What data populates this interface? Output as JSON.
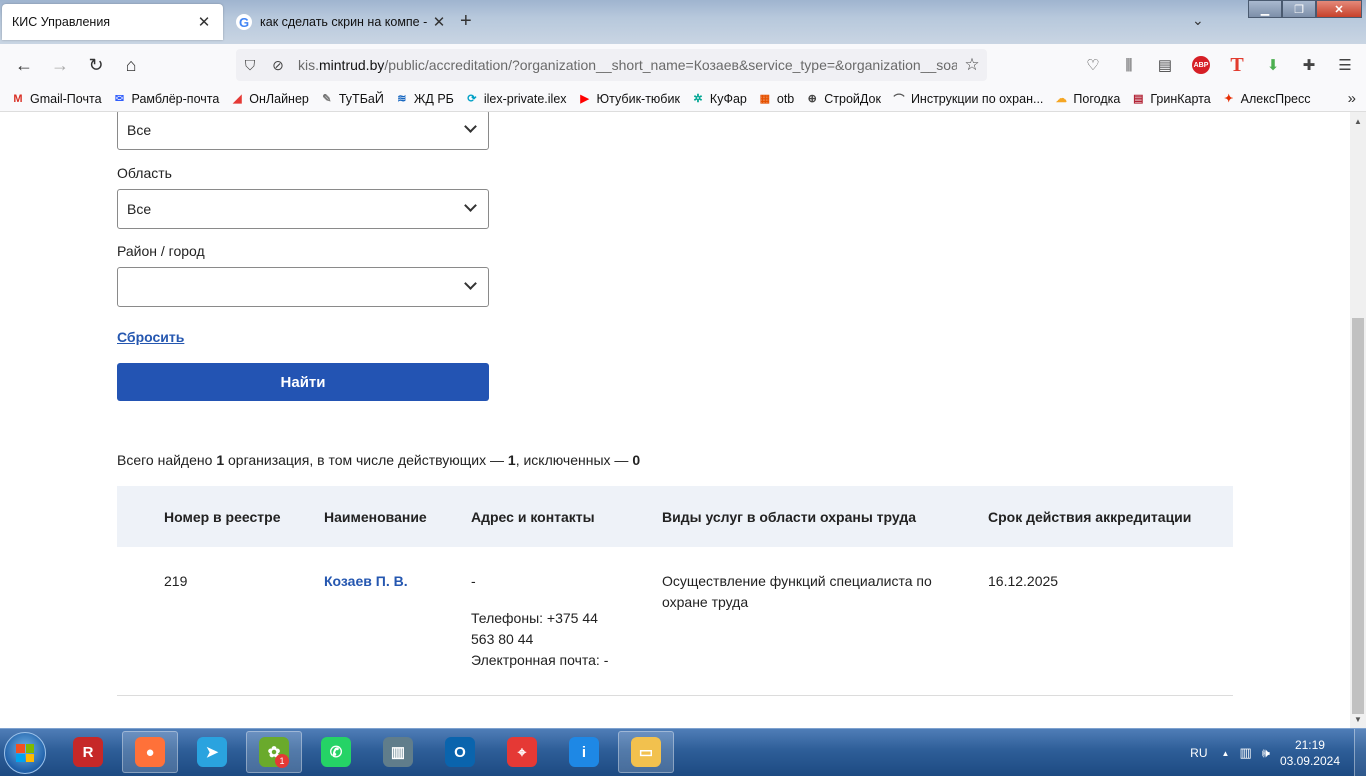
{
  "browser": {
    "tabs": [
      {
        "title": "КИС Управления",
        "active": true
      },
      {
        "title": "как сделать скрин на компе - П",
        "active": false,
        "favicon": "G"
      }
    ],
    "new_tab": "+",
    "address": {
      "prefix": "kis.",
      "domain": "mintrud.by",
      "path": "/public/accreditation/?organization__short_name=Козаев&service_type=&organization__soato"
    },
    "bookmarks": [
      {
        "label": "Gmail-Почта",
        "icon": "gmail-icon",
        "glyph": "M",
        "color": "#d93025"
      },
      {
        "label": "Рамблёр-почта",
        "icon": "rambler-icon",
        "glyph": "✉",
        "color": "#315efb"
      },
      {
        "label": "ОнЛайнер",
        "icon": "onliner-icon",
        "glyph": "◢",
        "color": "#e53935"
      },
      {
        "label": "ТуТБаЙ",
        "icon": "tutby-icon",
        "glyph": "✎",
        "color": "#777777"
      },
      {
        "label": "ЖД РБ",
        "icon": "rw-icon",
        "glyph": "≋",
        "color": "#1565c0"
      },
      {
        "label": "ilex-private.ilex",
        "icon": "ilex-icon",
        "glyph": "⟳",
        "color": "#00a0c6"
      },
      {
        "label": "Ютубик-тюбик",
        "icon": "youtube-icon",
        "glyph": "▶",
        "color": "#ff0000"
      },
      {
        "label": "КуФар",
        "icon": "kufar-icon",
        "glyph": "✲",
        "color": "#00a693"
      },
      {
        "label": "otb",
        "icon": "otb-icon",
        "glyph": "▦",
        "color": "#e65100"
      },
      {
        "label": "СтройДок",
        "icon": "globe-icon",
        "glyph": "⊕",
        "color": "#444444"
      },
      {
        "label": "Инструкции по охран...",
        "icon": "instructions-icon",
        "glyph": "⌒",
        "color": "#555555"
      },
      {
        "label": "Погодка",
        "icon": "weather-icon",
        "glyph": "☁",
        "color": "#f5a623"
      },
      {
        "label": "ГринКарта",
        "icon": "us-flag-icon",
        "glyph": "▤",
        "color": "#b22234"
      },
      {
        "label": "АлексПресс",
        "icon": "aliexpress-icon",
        "glyph": "✦",
        "color": "#e62e04"
      }
    ]
  },
  "filters": {
    "first_select_value": "Все",
    "region_label": "Область",
    "region_value": "Все",
    "district_label": "Район / город",
    "district_value": "",
    "reset_label": "Сбросить",
    "search_label": "Найти"
  },
  "summary": {
    "t1": "Всего найдено ",
    "total": "1",
    "t2": " организация, в том числе действующих — ",
    "active": "1",
    "t3": ", исключенных — ",
    "excluded": "0"
  },
  "table": {
    "headers": [
      "Номер в реестре",
      "Наименование",
      "Адрес и контакты",
      "Виды услуг в области охраны труда",
      "Срок действия аккредитации"
    ],
    "rows": [
      {
        "number": "219",
        "name": "Козаев П. В.",
        "address": "-",
        "phone_line1": "Телефоны: +375 44",
        "phone_line2": "563 80 44",
        "email": "Электронная почта:  -",
        "service_line1": "Осуществление функций специалиста по",
        "service_line2": "охране труда",
        "expiry": "16.12.2025"
      }
    ]
  },
  "taskbar": {
    "apps": [
      {
        "name": "r-app",
        "glyph": "R",
        "color": "#c62828"
      },
      {
        "name": "firefox",
        "glyph": "●",
        "color": "#ff7139",
        "open": true
      },
      {
        "name": "telegram",
        "glyph": "➤",
        "color": "#2aa3df"
      },
      {
        "name": "mail-agent",
        "glyph": "✿",
        "color": "#6aaa2c",
        "open": true,
        "badge": "1"
      },
      {
        "name": "whatsapp",
        "glyph": "✆",
        "color": "#25d366"
      },
      {
        "name": "copier",
        "glyph": "▥",
        "color": "#607d8b"
      },
      {
        "name": "outlook",
        "glyph": "O",
        "color": "#0a64ad"
      },
      {
        "name": "ie-tool",
        "glyph": "⌖",
        "color": "#e53935"
      },
      {
        "name": "info",
        "glyph": "i",
        "color": "#1e88e5"
      },
      {
        "name": "explorer",
        "glyph": "▭",
        "color": "#f2c14e",
        "open": true
      }
    ],
    "tray": {
      "lang": "RU",
      "time": "21:19",
      "date": "03.09.2024"
    }
  }
}
